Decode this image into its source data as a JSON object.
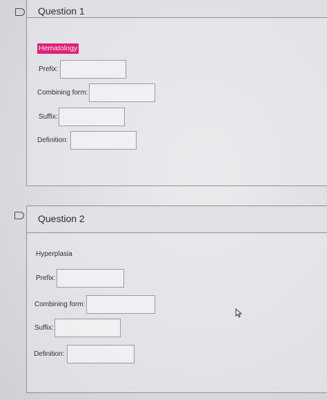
{
  "question1": {
    "title": "Question 1",
    "term": "Hematology",
    "highlight_color": "#e0207a",
    "fields": {
      "prefix": "Prefix:",
      "combining_form": "Combining form:",
      "suffix": "Suffix:",
      "definition": "Definition:"
    }
  },
  "question2": {
    "title": "Question 2",
    "term": "Hyperplasia",
    "fields": {
      "prefix": "Prefix:",
      "combining_form": "Combining form:",
      "suffix": "Suffix:",
      "definition": "Definition:"
    }
  },
  "icons": {
    "flag": "flag-icon",
    "cursor": "mouse-pointer-icon"
  }
}
